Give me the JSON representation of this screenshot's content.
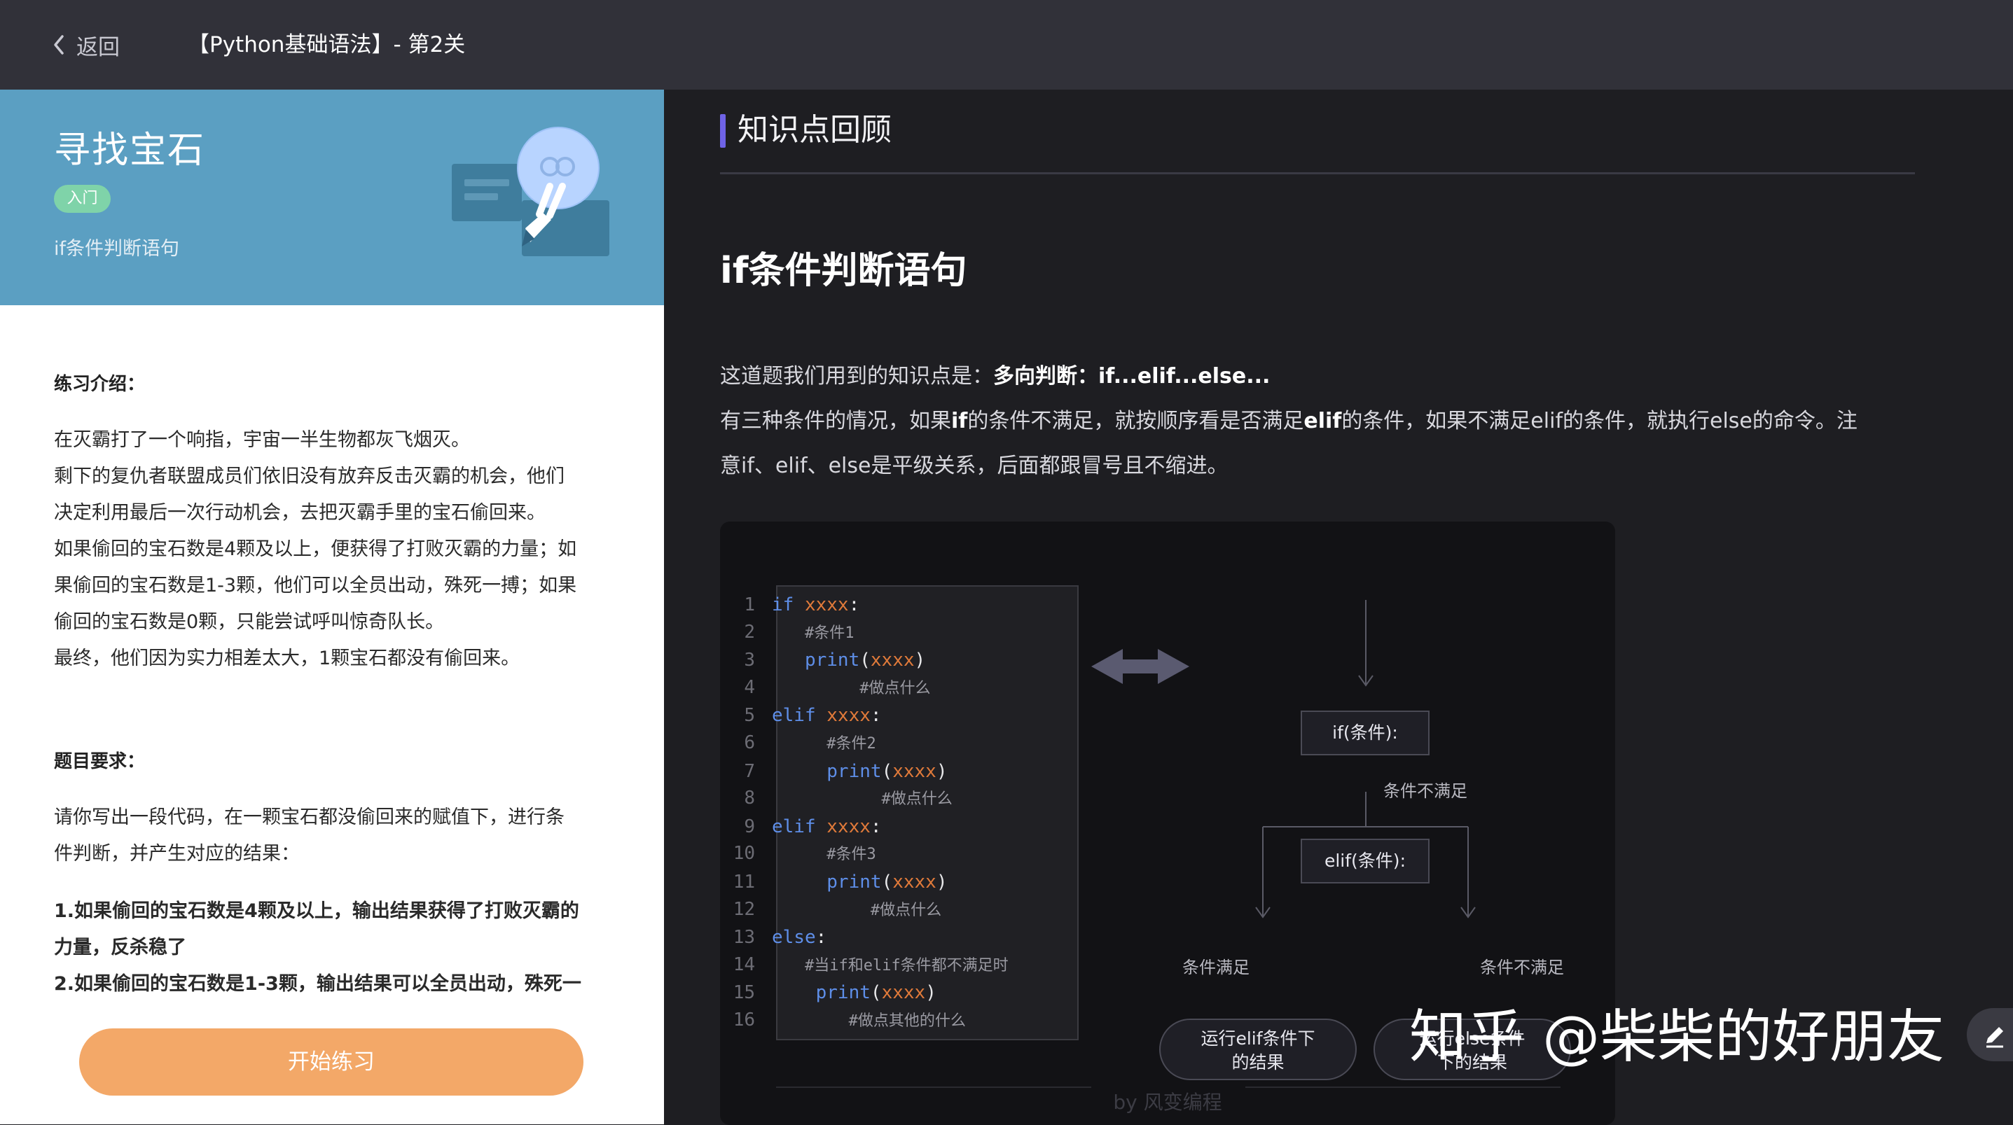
{
  "header": {
    "back_label": "返回",
    "title": "【Python基础语法】- 第2关"
  },
  "lesson": {
    "title": "寻找宝石",
    "level": "入门",
    "subtitle": "if条件判断语句"
  },
  "intro": {
    "heading": "练习介绍：",
    "lines": [
      "在灭霸打了一个响指，宇宙一半生物都灰飞烟灭。",
      "剩下的复仇者联盟成员们依旧没有放弃反击灭霸的机会，他们",
      "决定利用最后一次行动机会，去把灭霸手里的宝石偷回来。",
      "如果偷回的宝石数是4颗及以上，便获得了打败灭霸的力量；如",
      "果偷回的宝石数是1-3颗，他们可以全员出动，殊死一搏；如果",
      "偷回的宝石数是0颗，只能尝试呼叫惊奇队长。",
      "最终，他们因为实力相差太大，1颗宝石都没有偷回来。"
    ]
  },
  "requirements": {
    "heading": "题目要求：",
    "lines": [
      "请你写出一段代码，在一颗宝石都没偷回来的赋值下，进行条",
      "件判断，并产生对应的结果："
    ],
    "items": [
      "1.如果偷回的宝石数是4颗及以上，输出结果获得了打败灭霸的",
      "力量，反杀稳了",
      "2.如果偷回的宝石数是1-3颗，输出结果可以全员出动，殊死一"
    ]
  },
  "start_button": "开始练习",
  "knowledge": {
    "section_title": "知识点回顾",
    "heading": "if条件判断语句",
    "line1_prefix": "这道题我们用到的知识点是：",
    "line1_bold": "多向判断：if...elif...else...",
    "line2_a": "有三种条件的情况，如果",
    "line2_b": "if",
    "line2_c": "的条件不满足，就按顺序看是否满足",
    "line2_d": "elif",
    "line2_e": "的条件，如果不满足elif的条件，就执行else的命令。注",
    "line3": "意if、elif、else是平级关系，后面都跟冒号且不缩进。"
  },
  "diagram": {
    "code": [
      {
        "n": "1",
        "indent": "",
        "kw": "if",
        "var": " xxxx",
        "end": ":"
      },
      {
        "n": "2",
        "indent": "   ",
        "comment": "#条件1"
      },
      {
        "n": "3",
        "indent": "   ",
        "fn": "print",
        "arg": "xxxx"
      },
      {
        "n": "4",
        "indent": "        ",
        "comment": "#做点什么"
      },
      {
        "n": "5",
        "indent": "",
        "kw": "elif",
        "var": " xxxx",
        "end": ":"
      },
      {
        "n": "6",
        "indent": "     ",
        "comment": "#条件2"
      },
      {
        "n": "7",
        "indent": "     ",
        "fn": "print",
        "arg": "xxxx"
      },
      {
        "n": "8",
        "indent": "          ",
        "comment": "#做点什么"
      },
      {
        "n": "9",
        "indent": "",
        "kw": "elif",
        "var": " xxxx",
        "end": ":"
      },
      {
        "n": "10",
        "indent": "     ",
        "comment": "#条件3"
      },
      {
        "n": "11",
        "indent": "     ",
        "fn": "print",
        "arg": "xxxx"
      },
      {
        "n": "12",
        "indent": "         ",
        "comment": "#做点什么"
      },
      {
        "n": "13",
        "indent": "",
        "kw": "else",
        "var": "",
        "end": ":"
      },
      {
        "n": "14",
        "indent": "   ",
        "comment": "#当if和elif条件都不满足时"
      },
      {
        "n": "15",
        "indent": "    ",
        "fn": "print",
        "arg": "xxxx"
      },
      {
        "n": "16",
        "indent": "       ",
        "comment": "#做点其他的什么"
      }
    ],
    "node_if": "if(条件):",
    "node_elif": "elif(条件):",
    "label_not_met_1": "条件不满足",
    "label_met": "条件满足",
    "label_not_met_2": "条件不满足",
    "result_elif_1": "运行elif条件下",
    "result_elif_2": "的结果",
    "result_else_1": "运行else条件",
    "result_else_2": "下的结果",
    "byline": "by 风变编程"
  },
  "watermark": "知乎 @柴柴的好朋友",
  "colors": {
    "accent_purple": "#6f63e6",
    "banner_blue": "#5b9fc2",
    "badge_green": "#7fd3a9",
    "button_orange": "#f3a868",
    "keyword_blue": "#5e8ee8",
    "var_orange": "#e07a3a"
  },
  "icons": {
    "back": "chevron-left-icon",
    "banner": "lightbulb-pencil-illustration",
    "arrow": "double-arrow-icon",
    "edit": "pencil-icon"
  }
}
